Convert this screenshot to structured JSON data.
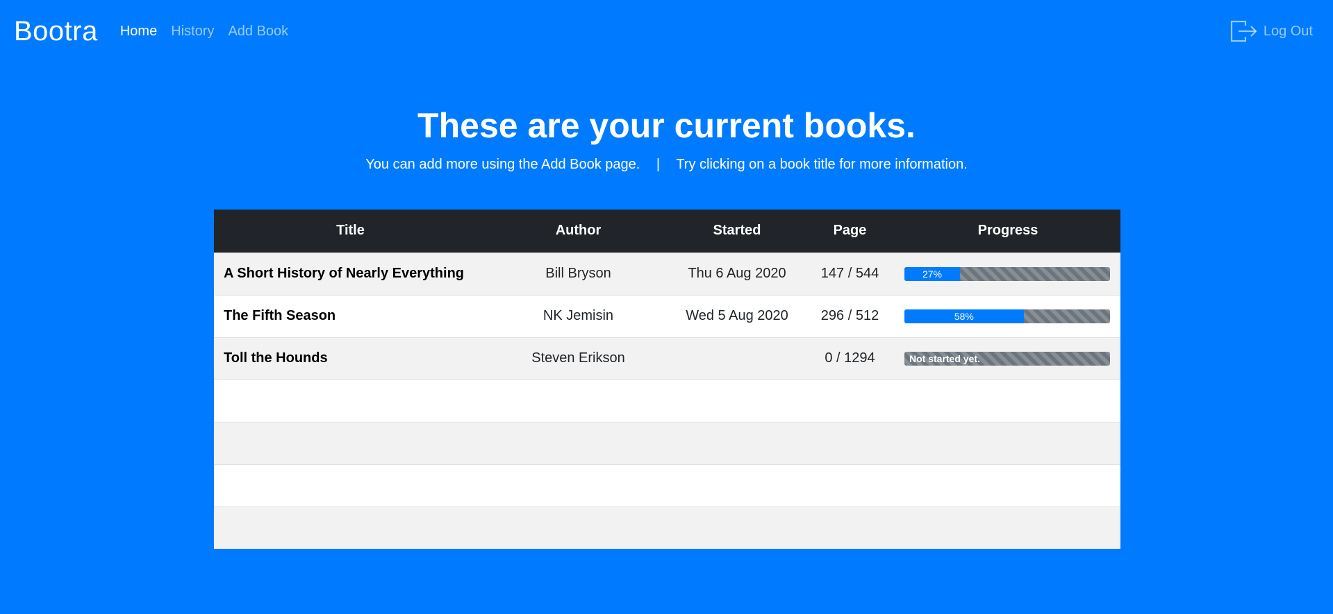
{
  "nav": {
    "brand": "Bootra",
    "links": [
      "Home",
      "History",
      "Add Book"
    ],
    "logout": "Log Out"
  },
  "hero": {
    "title": "These are your current books.",
    "sub_left": "You can add more using the Add Book page.",
    "separator": "|",
    "sub_right": "Try clicking on a book title for more information."
  },
  "table": {
    "headers": [
      "Title",
      "Author",
      "Started",
      "Page",
      "Progress"
    ],
    "rows": [
      {
        "title": "A Short History of Nearly Everything",
        "author": "Bill Bryson",
        "started": "Thu 6 Aug 2020",
        "page": "147 / 544",
        "progress": 27,
        "progress_label": "27%"
      },
      {
        "title": "The Fifth Season",
        "author": "NK Jemisin",
        "started": "Wed 5 Aug 2020",
        "page": "296 / 512",
        "progress": 58,
        "progress_label": "58%"
      },
      {
        "title": "Toll the Hounds",
        "author": "Steven Erikson",
        "started": "",
        "page": "0 / 1294",
        "progress": 0,
        "progress_label": "Not started yet."
      }
    ]
  },
  "colors": {
    "accent": "#007bff",
    "header_bg": "#212529",
    "bar_bg": "#6c757d"
  }
}
